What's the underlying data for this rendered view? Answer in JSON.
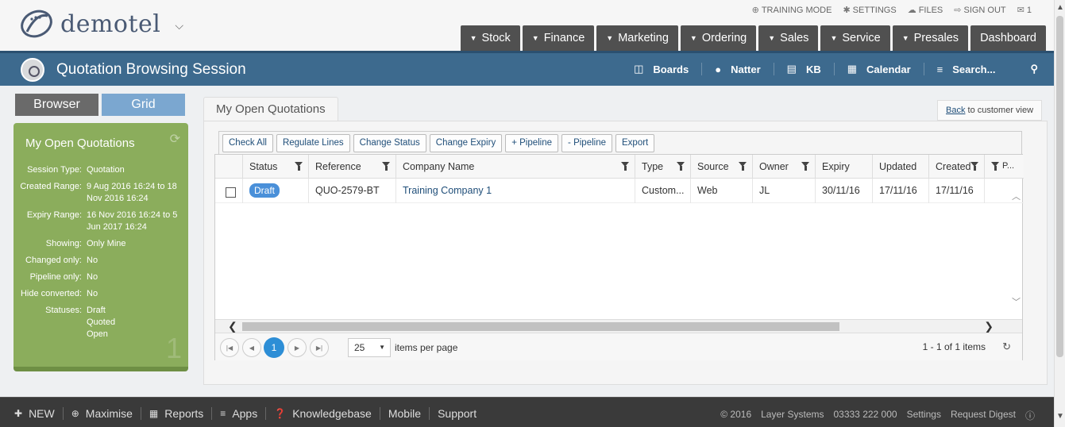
{
  "app": {
    "logo_text": "demotel"
  },
  "toplinks": [
    {
      "icon": "globe-icon",
      "glyph": "⊕",
      "label": "TRAINING MODE"
    },
    {
      "icon": "gear-icon",
      "glyph": "✱",
      "label": "SETTINGS"
    },
    {
      "icon": "cloud-icon",
      "glyph": "☁",
      "label": "FILES"
    },
    {
      "icon": "sign-out-icon",
      "glyph": "⇨",
      "label": "SIGN OUT"
    },
    {
      "icon": "chat-icon",
      "glyph": "✉",
      "label": "1"
    }
  ],
  "nav": [
    {
      "label": "Stock",
      "dropdown": true
    },
    {
      "label": "Finance",
      "dropdown": true
    },
    {
      "label": "Marketing",
      "dropdown": true
    },
    {
      "label": "Ordering",
      "dropdown": true
    },
    {
      "label": "Sales",
      "dropdown": true
    },
    {
      "label": "Service",
      "dropdown": true
    },
    {
      "label": "Presales",
      "dropdown": true
    },
    {
      "label": "Dashboard",
      "dropdown": false
    }
  ],
  "session": {
    "title": "Quotation Browsing Session",
    "tools": [
      {
        "icon": "boards-icon",
        "glyph": "◫",
        "label": "Boards"
      },
      {
        "icon": "natter-icon",
        "glyph": "●",
        "label": "Natter"
      },
      {
        "icon": "kb-icon",
        "glyph": "▤",
        "label": "KB"
      },
      {
        "icon": "calendar-icon",
        "glyph": "▦",
        "label": "Calendar"
      },
      {
        "icon": "menu-icon",
        "glyph": "≡",
        "label": "Search..."
      }
    ]
  },
  "left": {
    "browser_label": "Browser",
    "grid_label": "Grid",
    "panel_title": "My Open Quotations",
    "count": "1",
    "rows": [
      {
        "key": "Session Type:",
        "value": "Quotation"
      },
      {
        "key": "Created Range:",
        "value": "9 Aug 2016 16:24 to 18 Nov 2016 16:24"
      },
      {
        "key": "Expiry Range:",
        "value": "16 Nov 2016 16:24 to 5 Jun 2017 16:24"
      },
      {
        "key": "Showing:",
        "value": "Only Mine"
      },
      {
        "key": "Changed only:",
        "value": "No"
      },
      {
        "key": "Pipeline only:",
        "value": "No"
      },
      {
        "key": "Hide converted:",
        "value": "No"
      },
      {
        "key": "Statuses:",
        "value": "Draft\nQuoted\nOpen"
      }
    ]
  },
  "main": {
    "tab": "My Open Quotations",
    "back_link": "Back",
    "back_suffix": "to customer view",
    "toolbar": [
      "Check All",
      "Regulate Lines",
      "Change Status",
      "Change Expiry",
      "+ Pipeline",
      "- Pipeline",
      "Export"
    ],
    "columns": [
      "Status",
      "Reference",
      "Company Name",
      "Type",
      "Source",
      "Owner",
      "Expiry",
      "Updated",
      "Created",
      "P..."
    ],
    "rows": [
      {
        "status": "Draft",
        "reference": "QUO-2579-BT",
        "company": "Training Company 1",
        "type": "Custom...",
        "source": "Web",
        "owner": "JL",
        "expiry": "30/11/16",
        "updated": "17/11/16",
        "created": "17/11/16"
      }
    ],
    "pager": {
      "current_page": "1",
      "page_size": "25",
      "per_page_label": "items per page",
      "info": "1 - 1 of 1 items"
    }
  },
  "footer": {
    "left": [
      {
        "icon": "plus-icon",
        "glyph": "✚",
        "label": "NEW"
      },
      {
        "icon": "zoom-icon",
        "glyph": "⊕",
        "label": "Maximise"
      },
      {
        "icon": "table-icon",
        "glyph": "▦",
        "label": "Reports"
      },
      {
        "icon": "list-icon",
        "glyph": "≡",
        "label": "Apps"
      },
      {
        "icon": "question-icon",
        "glyph": "❓",
        "label": "Knowledgebase"
      },
      {
        "icon": "",
        "glyph": "",
        "label": "Mobile"
      },
      {
        "icon": "",
        "glyph": "",
        "label": "Support"
      }
    ],
    "copyright": "© 2016",
    "company": "Layer Systems",
    "phone": "03333 222 000",
    "settings": "Settings",
    "digest": "Request Digest"
  }
}
